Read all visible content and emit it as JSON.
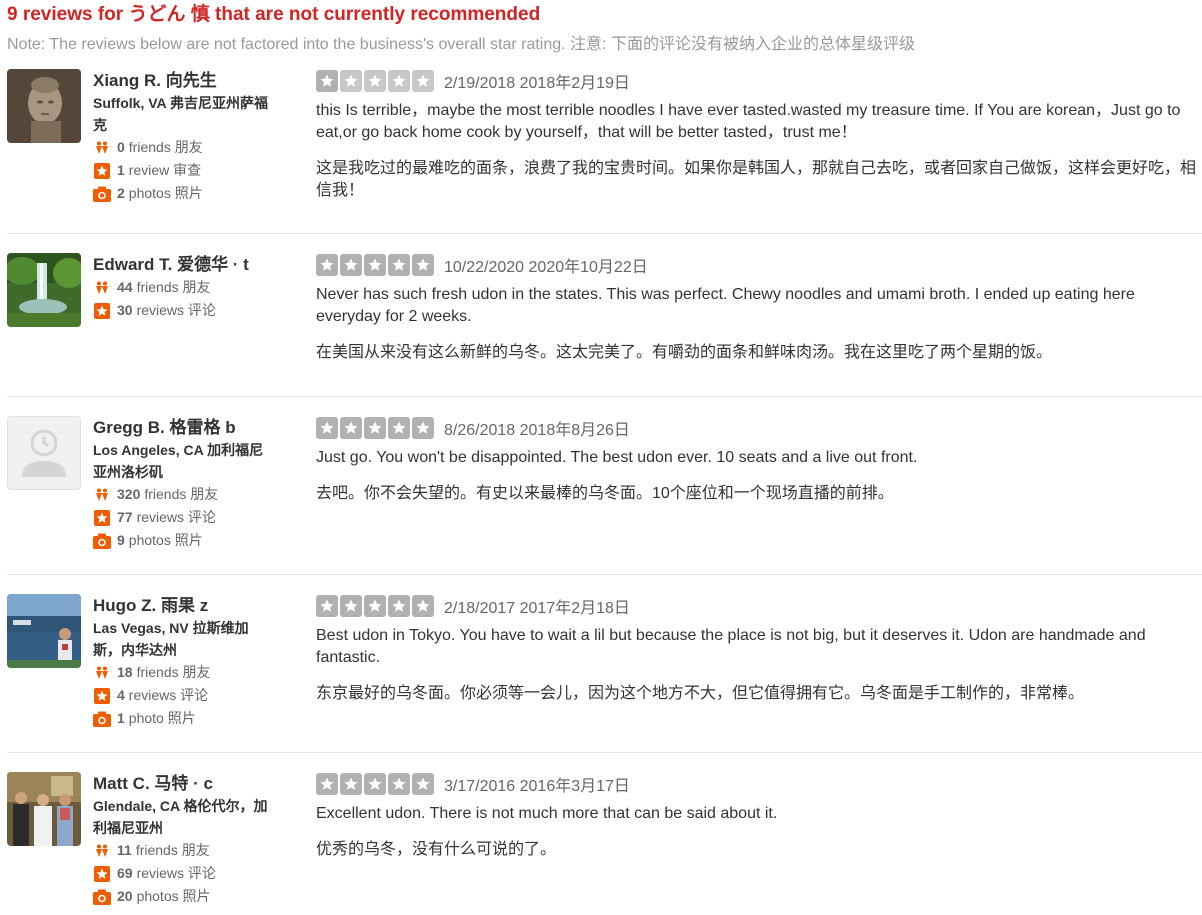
{
  "header": {
    "title": "9 reviews for うどん 慎 that are not currently recommended",
    "note": "Note: The reviews below are not factored into the business's overall star rating. 注意: 下面的评论没有被纳入企业的总体星级评级"
  },
  "icons": {
    "friends": "friends-icon",
    "reviews": "review-star-icon",
    "photos": "camera-icon",
    "star": "star-icon"
  },
  "colors": {
    "title": "#d32323",
    "accent": "#f15c00",
    "star_bg": "#c7c7c7"
  },
  "reviews": [
    {
      "name": "Xiang R. 向先生",
      "location": "Suffolk, VA 弗吉尼亚州萨福克",
      "friends_count": "0",
      "friends_label": "friends 朋友",
      "reviews_count": "1",
      "reviews_label": "review 审查",
      "photos_count": "2",
      "photos_label": "photos 照片",
      "rating": 1,
      "date": "2/19/2018 2018年2月19日",
      "text_en": "this Is terrible，maybe the most terrible noodles I have ever tasted.wasted my treasure time. If You are korean，Just go to eat,or go back home cook by yourself，that will be better tasted，trust me！",
      "text_zh": "这是我吃过的最难吃的面条，浪费了我的宝贵时间。如果你是韩国人，那就自己去吃，或者回家自己做饭，这样会更好吃，相信我！",
      "avatar": "statue-photo"
    },
    {
      "name": "Edward T. 爱德华 · t",
      "location": "",
      "friends_count": "44",
      "friends_label": "friends 朋友",
      "reviews_count": "30",
      "reviews_label": "reviews 评论",
      "photos_count": "",
      "photos_label": "",
      "rating": 5,
      "date": "10/22/2020 2020年10月22日",
      "text_en": "Never has such fresh udon in the states. This was perfect. Chewy noodles and umami broth. I ended up eating here everyday for 2 weeks.",
      "text_zh": "在美国从来没有这么新鲜的乌冬。这太完美了。有嚼劲的面条和鲜味肉汤。我在这里吃了两个星期的饭。",
      "avatar": "waterfall-photo"
    },
    {
      "name": "Gregg B. 格雷格 b",
      "location": "Los Angeles, CA 加利福尼亚州洛杉矶",
      "friends_count": "320",
      "friends_label": "friends 朋友",
      "reviews_count": "77",
      "reviews_label": "reviews 评论",
      "photos_count": "9",
      "photos_label": "photos 照片",
      "rating": 5,
      "date": "8/26/2018 2018年8月26日",
      "text_en": "Just go.  You won't be disappointed.  The best udon ever.  10 seats and a live out front.",
      "text_zh": "去吧。你不会失望的。有史以来最棒的乌冬面。10个座位和一个现场直播的前排。",
      "avatar": "default-avatar"
    },
    {
      "name": "Hugo Z. 雨果 z",
      "location": "Las Vegas, NV 拉斯维加斯，内华达州",
      "friends_count": "18",
      "friends_label": "friends 朋友",
      "reviews_count": "4",
      "reviews_label": "reviews 评论",
      "photos_count": "1",
      "photos_label": "photo 照片",
      "rating": 5,
      "date": "2/18/2017 2017年2月18日",
      "text_en": "Best udon in Tokyo. You have to wait a lil but because the place is not big, but it deserves it. Udon are handmade and fantastic.",
      "text_zh": "东京最好的乌冬面。你必须等一会儿，因为这个地方不大，但它值得拥有它。乌冬面是手工制作的，非常棒。",
      "avatar": "stadium-photo"
    },
    {
      "name": "Matt C. 马特 · c",
      "location": "Glendale, CA 格伦代尔，加利福尼亚州",
      "friends_count": "11",
      "friends_label": "friends 朋友",
      "reviews_count": "69",
      "reviews_label": "reviews 评论",
      "photos_count": "20",
      "photos_label": "photos 照片",
      "rating": 5,
      "date": "3/17/2016 2016年3月17日",
      "text_en": "Excellent udon. There is not much more that can be said about it.",
      "text_zh": "优秀的乌冬，没有什么可说的了。",
      "avatar": "group-photo"
    }
  ]
}
